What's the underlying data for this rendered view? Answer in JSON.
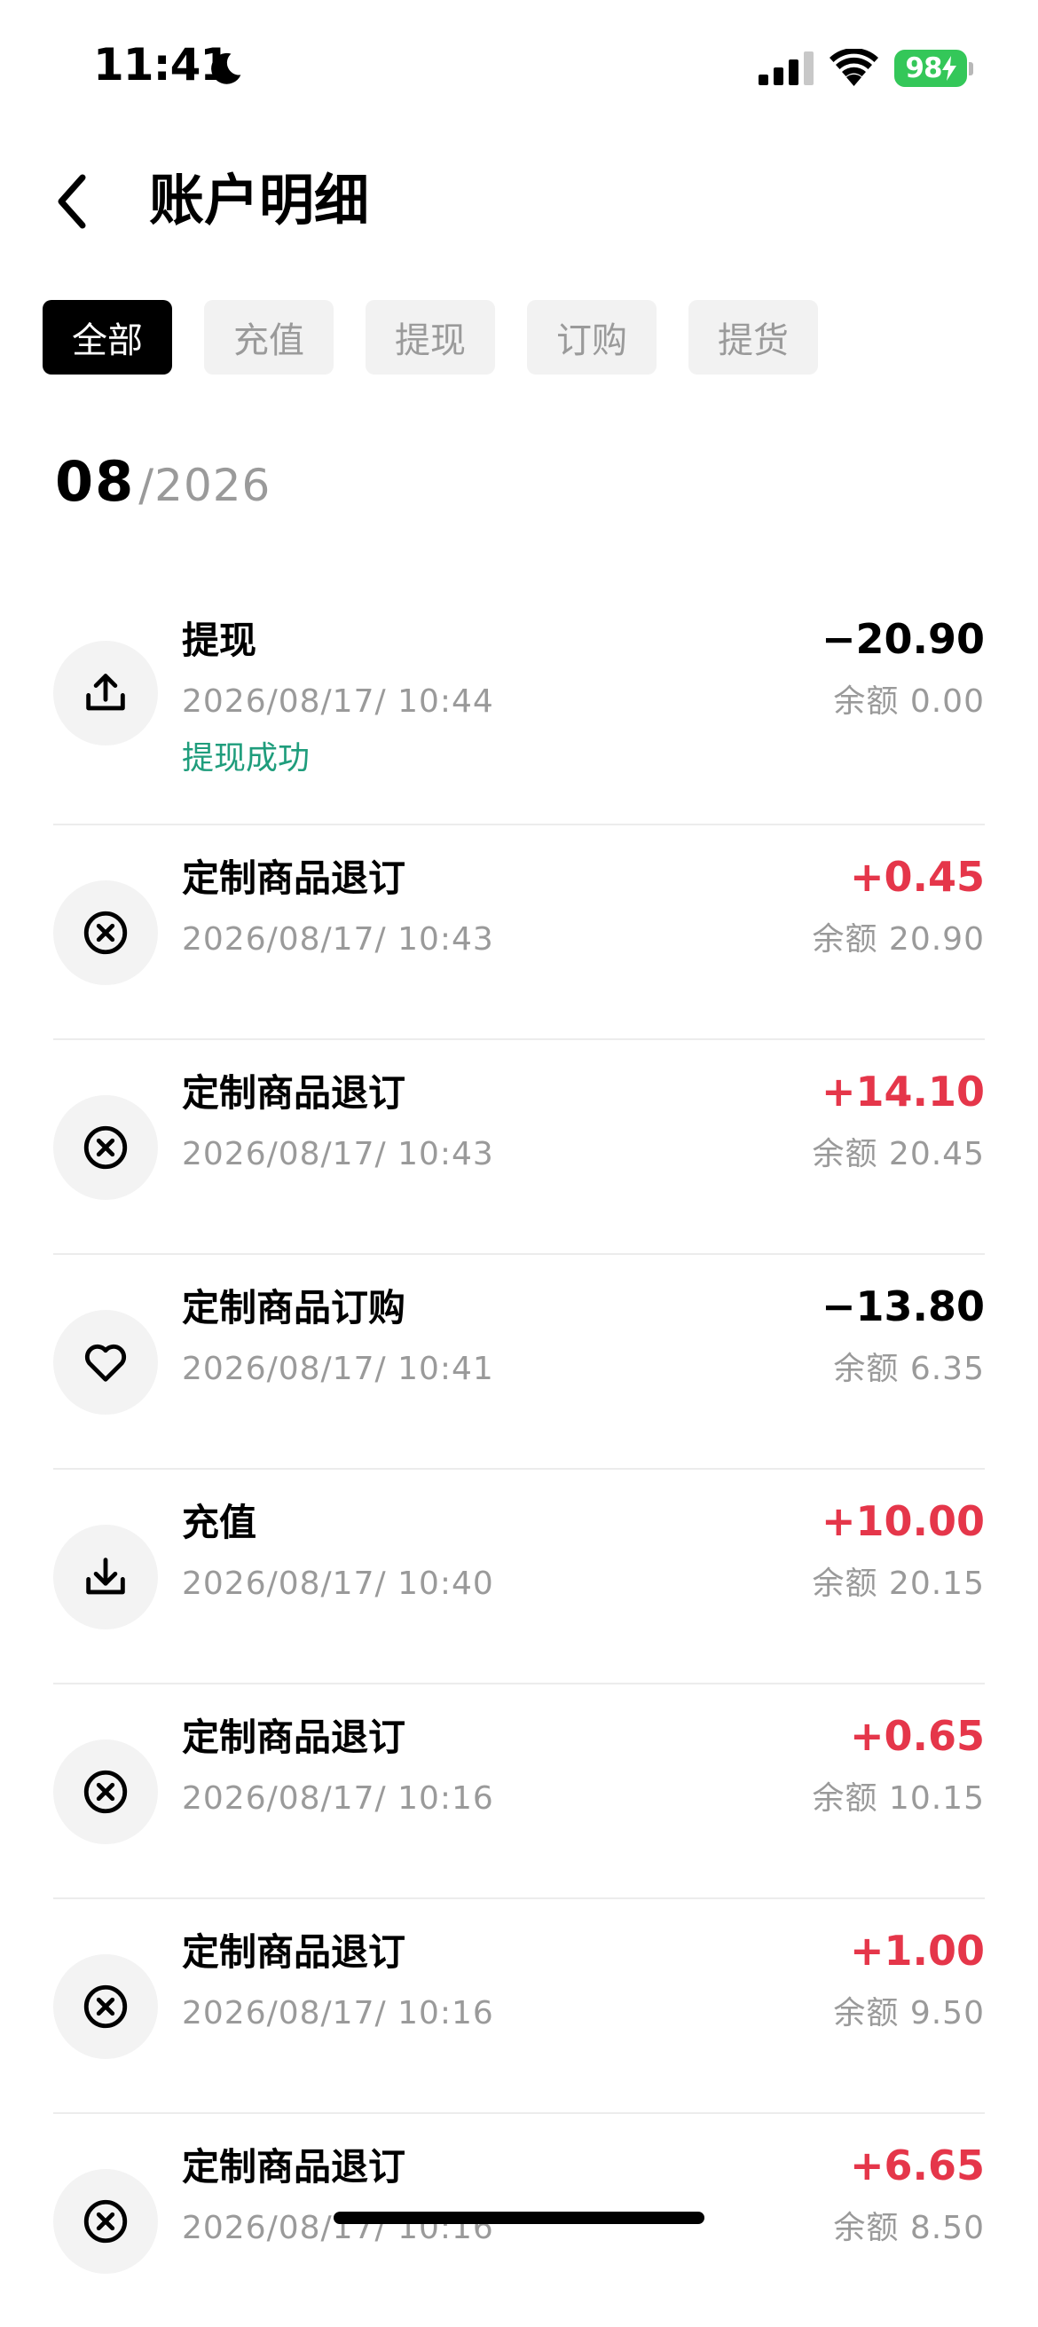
{
  "status_bar": {
    "time": "11:41",
    "battery": "98"
  },
  "header": {
    "title": "账户明细"
  },
  "tabs": [
    {
      "label": "全部",
      "active": true
    },
    {
      "label": "充值",
      "active": false
    },
    {
      "label": "提现",
      "active": false
    },
    {
      "label": "订购",
      "active": false
    },
    {
      "label": "提货",
      "active": false
    }
  ],
  "month_heading": {
    "month": "08",
    "year": "/2026"
  },
  "transactions": [
    {
      "icon": "upload-icon",
      "title": "提现",
      "time": "2026/08/17/ 10:44",
      "status": "提现成功",
      "amount": "−20.90",
      "sign": "neg",
      "balance": "余额 0.00"
    },
    {
      "icon": "cancel-circle-icon",
      "title": "定制商品退订",
      "time": "2026/08/17/ 10:43",
      "amount": "+0.45",
      "sign": "pos",
      "balance": "余额 20.90"
    },
    {
      "icon": "cancel-circle-icon",
      "title": "定制商品退订",
      "time": "2026/08/17/ 10:43",
      "amount": "+14.10",
      "sign": "pos",
      "balance": "余额 20.45"
    },
    {
      "icon": "heart-icon",
      "title": "定制商品订购",
      "time": "2026/08/17/ 10:41",
      "amount": "−13.80",
      "sign": "neg",
      "balance": "余额 6.35"
    },
    {
      "icon": "download-icon",
      "title": "充值",
      "time": "2026/08/17/ 10:40",
      "amount": "+10.00",
      "sign": "pos",
      "balance": "余额 20.15"
    },
    {
      "icon": "cancel-circle-icon",
      "title": "定制商品退订",
      "time": "2026/08/17/ 10:16",
      "amount": "+0.65",
      "sign": "pos",
      "balance": "余额 10.15"
    },
    {
      "icon": "cancel-circle-icon",
      "title": "定制商品退订",
      "time": "2026/08/17/ 10:16",
      "amount": "+1.00",
      "sign": "pos",
      "balance": "余额 9.50"
    },
    {
      "icon": "cancel-circle-icon",
      "title": "定制商品退订",
      "time": "2026/08/17/ 10:16",
      "amount": "+6.65",
      "sign": "pos",
      "balance": "余额 8.50"
    }
  ],
  "colors": {
    "positive": "#e5364a",
    "negative": "#000000",
    "success": "#1f9d7c",
    "battery": "#34c759"
  }
}
